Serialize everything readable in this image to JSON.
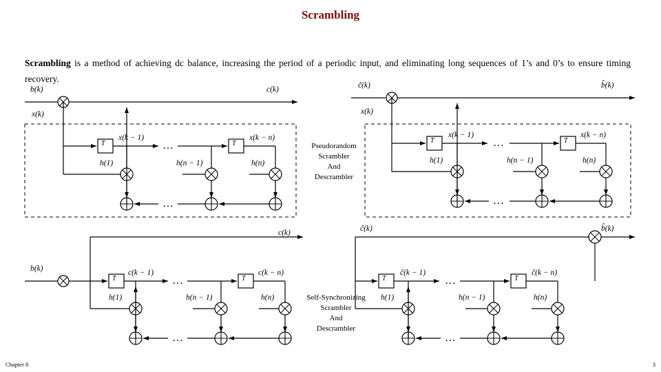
{
  "slide": {
    "title": "Scrambling",
    "footer_left": "Chapter 8",
    "footer_right": "3",
    "paragraph_lead": "Scrambling",
    "paragraph_rest": " is a method of achieving dc balance, increasing the period of a periodic input, and eliminating long sequences of 1’s and 0’s to ensure timing recovery.",
    "accent_color": "#7b0a0a"
  },
  "center_labels": {
    "top": [
      "Pseudorandom",
      "Scrambler",
      "And",
      "Descrambler"
    ],
    "bottom": [
      "Self-Synchronizing",
      "Scrambler",
      "And",
      "Descrambler"
    ]
  },
  "diagrams": {
    "top_left": {
      "name": "pseudorandom-scrambler",
      "in_left": "b(k)",
      "out_right": "c(k)",
      "state_in": "x(k)",
      "delay_label": "T",
      "reg1": "x(k − 1)",
      "regn": "x(k − n)",
      "tap1": "h(1)",
      "tapn1": "h(n − 1)",
      "tapn": "h(n)",
      "ellipsis": "…"
    },
    "top_right": {
      "name": "pseudorandom-descrambler",
      "in_left": "ĉ(k)",
      "out_right": "b̂(k)",
      "state_in": "x(k)",
      "delay_label": "T",
      "reg1": "x(k − 1)",
      "regn": "x(k − n)",
      "tap1": "h(1)",
      "tapn1": "h(n − 1)",
      "tapn": "h(n)",
      "ellipsis": "…"
    },
    "bottom_left": {
      "name": "selfsync-scrambler",
      "in_left": "b(k)",
      "out_top": "c(k)",
      "delay_label": "T",
      "reg1": "c(k − 1)",
      "regn": "c(k − n)",
      "tap1": "h(1)",
      "tapn1": "h(n − 1)",
      "tapn": "h(n)",
      "ellipsis": "…"
    },
    "bottom_right": {
      "name": "selfsync-descrambler",
      "in_top": "ĉ(k)",
      "out_right": "b̂(k)",
      "delay_label": "T",
      "reg1": "ĉ(k − 1)",
      "regn": "ĉ(k − n)",
      "tap1": "h(1)",
      "tapn1": "h(n − 1)",
      "tapn": "h(n)",
      "ellipsis": "…"
    }
  }
}
